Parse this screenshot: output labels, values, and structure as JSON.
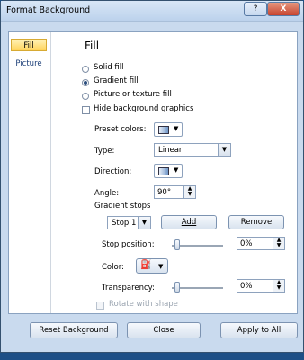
{
  "window": {
    "title": "Format Background",
    "help_icon": "?",
    "close_icon": "X"
  },
  "nav": {
    "items": [
      {
        "label": "Fill",
        "selected": true
      },
      {
        "label": "Picture",
        "selected": false
      }
    ]
  },
  "fill": {
    "heading": "Fill",
    "options": [
      {
        "label": "Solid fill",
        "selected": false
      },
      {
        "label": "Gradient fill",
        "selected": true
      },
      {
        "label": "Picture or texture fill",
        "selected": false
      }
    ],
    "hide_background_graphics": {
      "label": "Hide background graphics",
      "checked": false
    },
    "preset_colors_label": "Preset colors:",
    "type_label": "Type:",
    "type_value": "Linear",
    "direction_label": "Direction:",
    "angle_label": "Angle:",
    "angle_value": "90°",
    "gradient_stops_label": "Gradient stops",
    "stop_value": "Stop 1",
    "add_label": "Add",
    "remove_label": "Remove",
    "stop_position_label": "Stop position:",
    "stop_position_value": "0%",
    "stop_position_level": 0,
    "color_label": "Color:",
    "transparency_label": "Transparency:",
    "transparency_value": "0%",
    "transparency_level": 0,
    "rotate_with_shape": {
      "label": "Rotate with shape",
      "checked": false,
      "disabled": true
    }
  },
  "footer": {
    "reset_label": "Reset Background",
    "close_label": "Close",
    "apply_all_label": "Apply to All"
  }
}
